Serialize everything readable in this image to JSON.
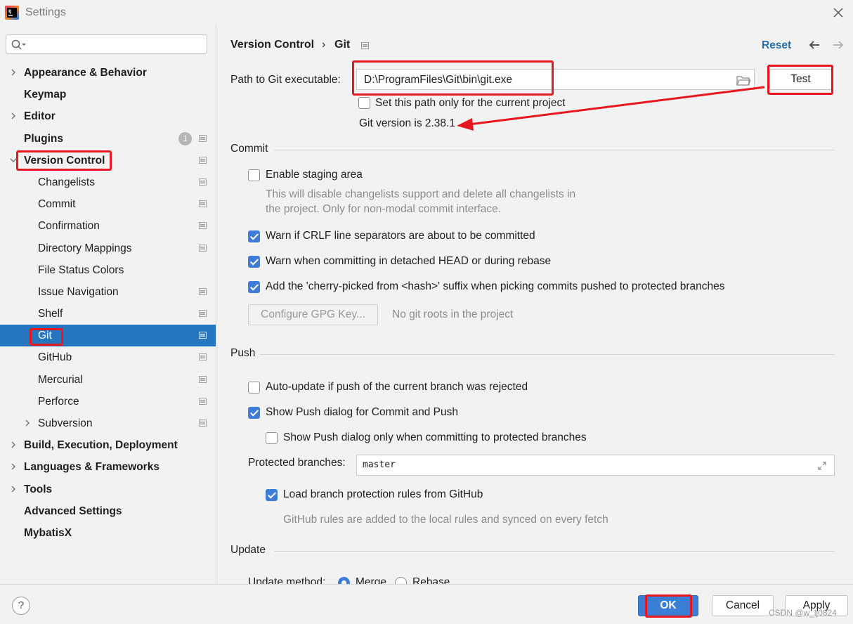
{
  "window": {
    "title": "Settings",
    "icon": "intellij-icon",
    "close_icon": "close-icon"
  },
  "search": {
    "placeholder": "",
    "icon": "search-icon"
  },
  "sidebar": {
    "items": [
      {
        "label": "Appearance & Behavior",
        "bold": true,
        "expandable": true
      },
      {
        "label": "Keymap",
        "bold": true
      },
      {
        "label": "Editor",
        "bold": true,
        "expandable": true
      },
      {
        "label": "Plugins",
        "bold": true,
        "badge": "1",
        "project_icon": true
      },
      {
        "label": "Version Control",
        "bold": true,
        "expanded": true,
        "project_icon": true
      },
      {
        "label": "Changelists",
        "child": true,
        "project_icon": true
      },
      {
        "label": "Commit",
        "child": true,
        "project_icon": true
      },
      {
        "label": "Confirmation",
        "child": true,
        "project_icon": true
      },
      {
        "label": "Directory Mappings",
        "child": true,
        "project_icon": true
      },
      {
        "label": "File Status Colors",
        "child": true
      },
      {
        "label": "Issue Navigation",
        "child": true,
        "project_icon": true
      },
      {
        "label": "Shelf",
        "child": true,
        "project_icon": true
      },
      {
        "label": "Git",
        "child": true,
        "selected": true,
        "project_icon": true
      },
      {
        "label": "GitHub",
        "child": true,
        "project_icon": true
      },
      {
        "label": "Mercurial",
        "child": true,
        "project_icon": true
      },
      {
        "label": "Perforce",
        "child": true,
        "project_icon": true
      },
      {
        "label": "Subversion",
        "child": true,
        "expandable": true,
        "project_icon": true
      },
      {
        "label": "Build, Execution, Deployment",
        "bold": true,
        "expandable": true
      },
      {
        "label": "Languages & Frameworks",
        "bold": true,
        "expandable": true
      },
      {
        "label": "Tools",
        "bold": true,
        "expandable": true
      },
      {
        "label": "Advanced Settings",
        "bold": true
      },
      {
        "label": "MybatisX",
        "bold": true
      }
    ]
  },
  "breadcrumb": {
    "parent": "Version Control",
    "separator": "›",
    "current": "Git"
  },
  "header": {
    "reset": "Reset",
    "back_icon": "arrow-left-icon",
    "forward_icon": "arrow-right-icon"
  },
  "git": {
    "path_label": "Path to Git executable:",
    "path_value": "D:\\ProgramFiles\\Git\\bin\\git.exe",
    "browse_icon": "folder-icon",
    "test_button": "Test",
    "set_path_only": "Set this path only for the current project",
    "version_text": "Git version is 2.38.1"
  },
  "commit": {
    "title": "Commit",
    "enable_staging": "Enable staging area",
    "staging_desc_1": "This will disable changelists support and delete all changelists in",
    "staging_desc_2": "the project. Only for non-modal commit interface.",
    "warn_crlf": "Warn if CRLF line separators are about to be committed",
    "warn_detached": "Warn when committing in detached HEAD or during rebase",
    "cherry_pick": "Add the 'cherry-picked from <hash>' suffix when picking commits pushed to protected branches",
    "gpg_button": "Configure GPG Key...",
    "no_roots": "No git roots in the project"
  },
  "push": {
    "title": "Push",
    "auto_update": "Auto-update if push of the current branch was rejected",
    "show_push_dialog": "Show Push dialog for Commit and Push",
    "show_push_protected": "Show Push dialog only when committing to protected branches",
    "protected_label": "Protected branches:",
    "protected_value": "master",
    "expand_icon": "expand-icon",
    "load_rules": "Load branch protection rules from GitHub",
    "rules_desc": "GitHub rules are added to the local rules and synced on every fetch"
  },
  "update": {
    "title": "Update",
    "method_label": "Update method:",
    "merge": "Merge",
    "rebase": "Rebase"
  },
  "footer": {
    "help": "?",
    "ok": "OK",
    "cancel": "Cancel",
    "apply": "Apply",
    "watermark": "CSDN @w_lj0824"
  },
  "colors": {
    "selection": "#2675bf",
    "accent": "#3b7dd8",
    "annotation_red": "#e8161e",
    "link": "#2470b3"
  }
}
